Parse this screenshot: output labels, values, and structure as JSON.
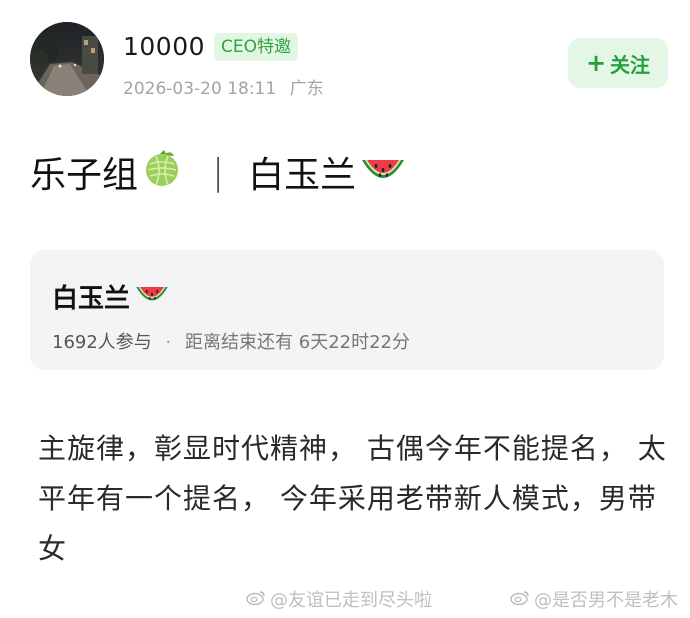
{
  "header": {
    "username": "10000",
    "badge": "CEO特邀",
    "date": "2026-03-20 18:11",
    "location": "广东",
    "follow_label": "关注",
    "follow_icon": "plus-icon"
  },
  "post": {
    "title_left": "乐子组",
    "title_left_emoji": "melon-emoji",
    "separator": "|",
    "title_right": "白玉兰",
    "title_right_emoji": "watermelon-emoji",
    "body": "主旋律，彰显时代精神， 古偶今年不能提名， 太平年有一个提名， 今年采用老带新人模式，男带女"
  },
  "poll": {
    "title": "白玉兰",
    "title_emoji": "watermelon-emoji",
    "participants": "1692人参与",
    "dot": "·",
    "remaining": "距离结束还有 6天22时22分"
  },
  "watermarks": {
    "left": "@友谊已走到尽头啦",
    "right": "@是否男不是老木"
  },
  "colors": {
    "accent_green": "#23a13c",
    "badge_bg": "#e3f6e4",
    "card_bg": "#f4f4f6"
  }
}
